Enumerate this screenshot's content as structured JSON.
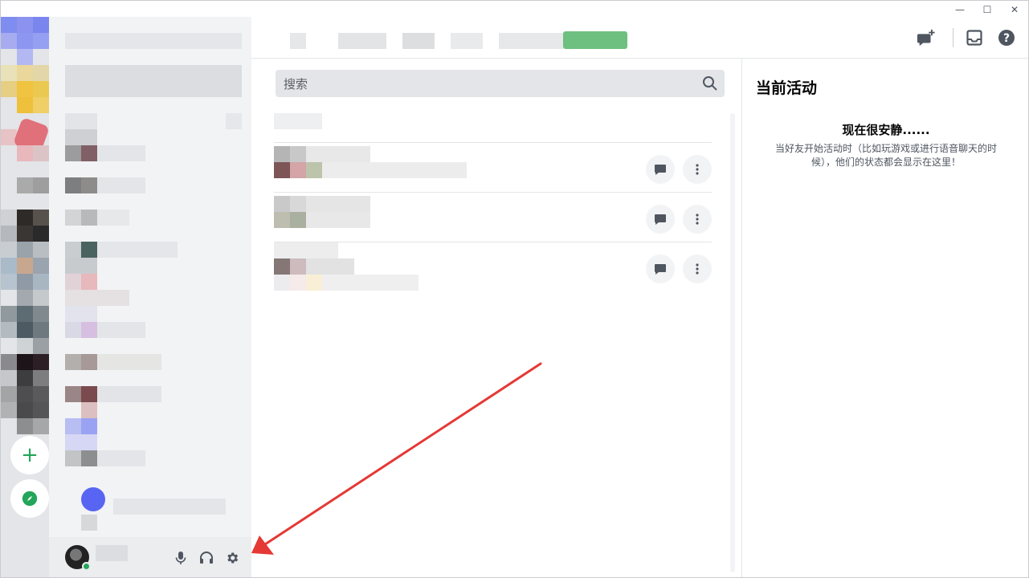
{
  "window": {
    "minimize_glyph": "—",
    "maximize_glyph": "☐",
    "close_glyph": "✕"
  },
  "header": {
    "new_group_dm_icon": "new-group-dm-icon",
    "inbox_icon": "inbox-icon",
    "help_icon": "help-icon"
  },
  "search": {
    "placeholder": "搜索"
  },
  "friends": {
    "rows": [
      {
        "message_icon": "message-icon",
        "more_icon": "more-icon"
      },
      {
        "message_icon": "message-icon",
        "more_icon": "more-icon"
      },
      {
        "message_icon": "message-icon",
        "more_icon": "more-icon"
      }
    ]
  },
  "activity": {
    "title": "当前活动",
    "quiet_title": "现在很安静......",
    "quiet_desc": "当好友开始活动时（比如玩游戏或进行语音聊天的时候），他们的状态都会显示在这里！"
  },
  "rail": {
    "add_server_icon": "add-server-icon",
    "explore_icon": "compass-icon"
  },
  "userbar": {
    "status": "online",
    "mic_icon": "microphone-icon",
    "headset_icon": "headset-icon",
    "settings_icon": "gear-icon"
  },
  "colors": {
    "accent": "#5865f2",
    "online": "#23a55a",
    "arrow": "#e53935"
  }
}
